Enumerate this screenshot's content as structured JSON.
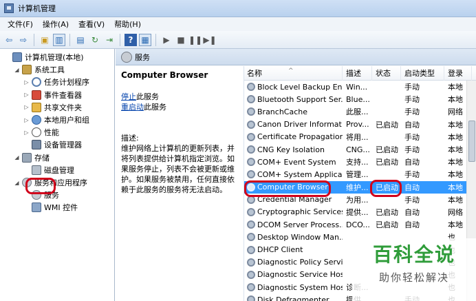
{
  "window": {
    "title": "计算机管理"
  },
  "menu": [
    "文件(F)",
    "操作(A)",
    "查看(V)",
    "帮助(H)"
  ],
  "tree": [
    {
      "label": "计算机管理(本地)",
      "expander": "",
      "icon": "computer-icon",
      "level": 0
    },
    {
      "label": "系统工具",
      "expander": "◢",
      "icon": "tools-icon",
      "level": 1
    },
    {
      "label": "任务计划程序",
      "expander": "▷",
      "icon": "clock-icon",
      "level": 2
    },
    {
      "label": "事件查看器",
      "expander": "▷",
      "icon": "event-viewer-icon",
      "level": 2
    },
    {
      "label": "共享文件夹",
      "expander": "▷",
      "icon": "shared-folder-icon",
      "level": 2
    },
    {
      "label": "本地用户和组",
      "expander": "▷",
      "icon": "users-icon",
      "level": 2
    },
    {
      "label": "性能",
      "expander": "▷",
      "icon": "performance-icon",
      "level": 2
    },
    {
      "label": "设备管理器",
      "expander": "",
      "icon": "device-manager-icon",
      "level": 2
    },
    {
      "label": "存储",
      "expander": "◢",
      "icon": "storage-icon",
      "level": 1
    },
    {
      "label": "磁盘管理",
      "expander": "",
      "icon": "disk-icon",
      "level": 2
    },
    {
      "label": "服务和应用程序",
      "expander": "◢",
      "icon": "services-apps-icon",
      "level": 1
    },
    {
      "label": "服务",
      "expander": "",
      "icon": "gear-icon",
      "level": 2
    },
    {
      "label": "WMI 控件",
      "expander": "",
      "icon": "wmi-icon",
      "level": 2
    }
  ],
  "pane": {
    "header": "服务"
  },
  "detail": {
    "title": "Computer Browser",
    "stop_link": "停止",
    "stop_suffix": "此服务",
    "restart_link": "重启动",
    "restart_suffix": "此服务",
    "desc_label": "描述:",
    "desc_text": "维护网络上计算机的更新列表，并将列表提供给计算机指定浏览。如果服务停止，列表不会被更新或维护。如果服务被禁用，任何直接依赖于此服务的服务将无法启动。"
  },
  "table": {
    "headers": [
      "名称",
      "描述",
      "状态",
      "启动类型",
      "登录"
    ],
    "rows": [
      [
        "Block Level Backup En...",
        "Win...",
        "",
        "手动",
        "本地"
      ],
      [
        "Bluetooth Support Ser...",
        "Blue...",
        "",
        "手动",
        "本地"
      ],
      [
        "BranchCache",
        "此服...",
        "",
        "手动",
        "网络"
      ],
      [
        "Canon Driver Informat...",
        "Prov...",
        "已启动",
        "自动",
        "本地"
      ],
      [
        "Certificate Propagation",
        "将用...",
        "",
        "手动",
        "本地"
      ],
      [
        "CNG Key Isolation",
        "CNG...",
        "已启动",
        "手动",
        "本地"
      ],
      [
        "COM+ Event System",
        "支持...",
        "已启动",
        "自动",
        "本地"
      ],
      [
        "COM+ System Applica...",
        "管理...",
        "",
        "手动",
        "本地"
      ],
      [
        "Computer Browser",
        "维护...",
        "已启动",
        "自动",
        "本地"
      ],
      [
        "Credential Manager",
        "为用...",
        "",
        "手动",
        "本地"
      ],
      [
        "Cryptographic Services",
        "提供...",
        "已启动",
        "自动",
        "网络"
      ],
      [
        "DCOM Server Process...",
        "DCO...",
        "已启动",
        "自动",
        "本地"
      ],
      [
        "Desktop Window Man...",
        "",
        "",
        "",
        "也"
      ],
      [
        "DHCP Client",
        "",
        "",
        "",
        "也"
      ],
      [
        "Diagnostic Policy Servi...",
        "",
        "",
        "",
        "也"
      ],
      [
        "Diagnostic Service Host",
        "",
        "",
        "",
        "也"
      ],
      [
        "Diagnostic System Host",
        "诊断...",
        "",
        "",
        "也"
      ],
      [
        "Disk Defragmenter",
        "提供...",
        "",
        "手动",
        "也"
      ]
    ],
    "selected_index": 8
  },
  "watermark": {
    "line1": "百科全说",
    "line2": "助你轻松解决"
  },
  "colors": {
    "selection": "#3399ff",
    "link": "#0645ad",
    "annotation": "#d0021b",
    "watermark": "#2f9c3a"
  }
}
